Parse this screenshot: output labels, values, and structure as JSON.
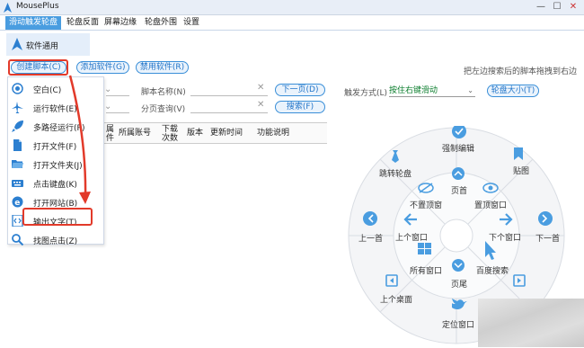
{
  "window": {
    "title": "MousePlus",
    "minimize": "—",
    "maximize": "☐",
    "close": "✕"
  },
  "menu": [
    "滑动触发轮盘",
    "轮盘反面",
    "屏幕边缘",
    "轮盘外围",
    "设置"
  ],
  "nav": {
    "label": "软件通用"
  },
  "buttons": {
    "create": "创建脚本(C)",
    "add": "添加软件(G)",
    "disable": "禁用软件(R)"
  },
  "hint": "把左边搜索后的脚本拖拽到右边",
  "filters": {
    "script_name_label": "脚本名称(N)",
    "page_query_label": "分页查询(V)",
    "next_page": "下一页(D)",
    "search": "搜索(F)",
    "trigger_label": "触发方式(L)",
    "trigger_value": "按住右键滑动",
    "wheel_size": "轮盘大小(T)"
  },
  "table_headers": [
    "属\n件",
    "所属账号",
    "下载\n次数",
    "版本",
    "更新时间",
    "功能说明"
  ],
  "dropdown": [
    "空白(C)",
    "运行软件(E)",
    "多路径运行(P)",
    "打开文件(F)",
    "打开文件夹(J)",
    "点击键盘(K)",
    "打开网站(B)",
    "输出文字(T)",
    "找图点击(Z)"
  ],
  "wheel": {
    "outer": [
      "强制编辑",
      "贴图",
      "下一首",
      "百度搜索",
      "定位窗口",
      "上个桌面",
      "上一首",
      "跳转轮盘"
    ],
    "inner": [
      "页首",
      "置顶窗口",
      "下个窗口",
      "页尾",
      "所有窗口",
      "上个窗口",
      "不置顶窗"
    ],
    "accent": "#4a9de0"
  },
  "colors": {
    "accent": "#4a9de0",
    "highlight": "#e23a2a"
  }
}
